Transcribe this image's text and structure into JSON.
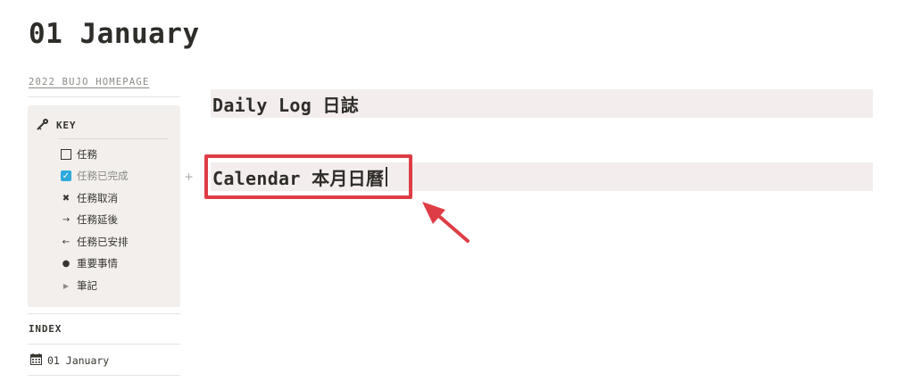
{
  "page": {
    "title": "01 January",
    "breadcrumb": "2022 BUJO HOMEPAGE"
  },
  "key": {
    "title": "KEY",
    "icon": "key-icon",
    "items": [
      {
        "icon": "checkbox-empty-icon",
        "label": "任務"
      },
      {
        "icon": "checkbox-checked-icon",
        "label": "任務已完成"
      },
      {
        "icon": "cross-icon",
        "label": "任務取消"
      },
      {
        "icon": "arrow-right-icon",
        "label": "任務延後"
      },
      {
        "icon": "arrow-left-icon",
        "label": "任務已安排"
      },
      {
        "icon": "bullet-icon",
        "label": "重要事情"
      },
      {
        "icon": "triangle-right-icon",
        "label": "筆記"
      }
    ]
  },
  "index": {
    "title": "INDEX",
    "items": [
      {
        "icon": "calendar-icon",
        "label": "01 January"
      }
    ]
  },
  "content": {
    "headings": [
      {
        "text": "Daily Log 日誌"
      },
      {
        "text": "Calendar 本月日曆"
      }
    ]
  },
  "annotation": {
    "highlight_color": "#de3d45"
  },
  "colors": {
    "heading_bg": "#f3eeed",
    "sidebar_bg": "#f2efed",
    "checkbox_accent": "#2eaadc"
  }
}
